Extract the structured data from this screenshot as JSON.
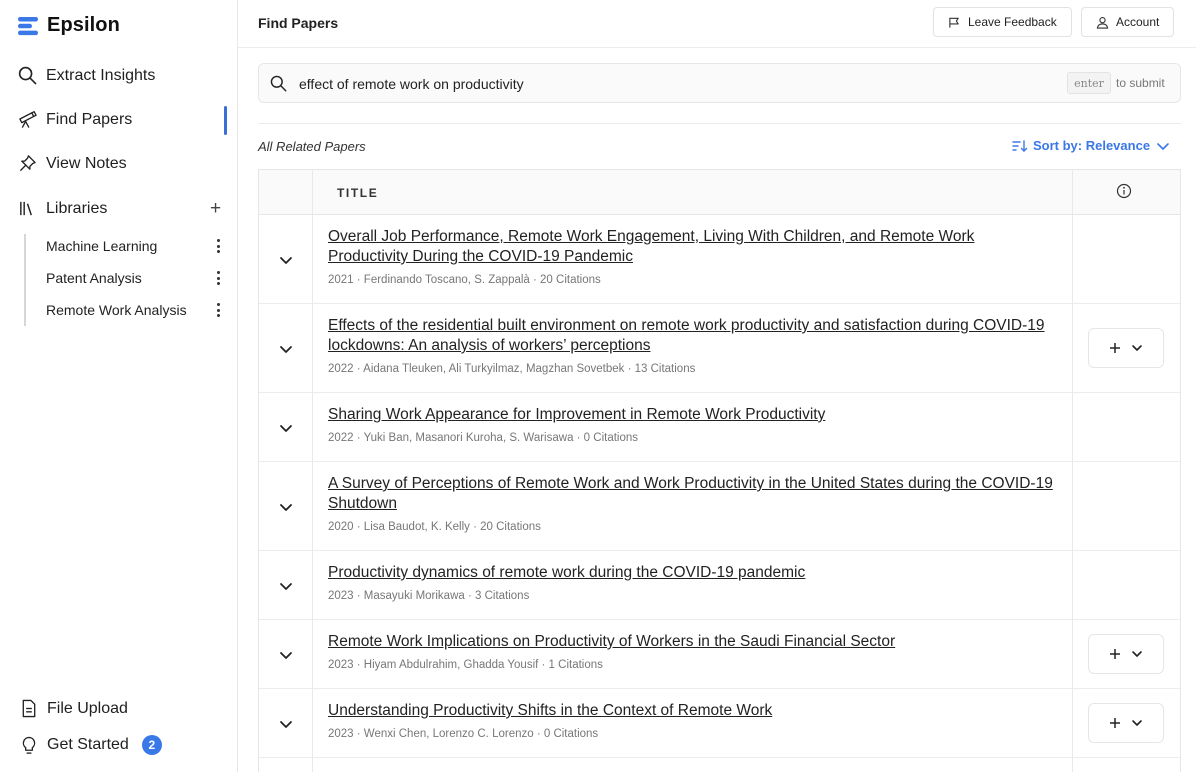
{
  "app": {
    "name": "Epsilon"
  },
  "sidebar": {
    "nav": [
      {
        "label": "Extract Insights",
        "icon": "search-icon"
      },
      {
        "label": "Find Papers",
        "icon": "telescope-icon",
        "active": true
      },
      {
        "label": "View Notes",
        "icon": "pin-icon"
      }
    ],
    "libraries": {
      "label": "Libraries",
      "items": [
        "Machine Learning",
        "Patent Analysis",
        "Remote Work Analysis"
      ]
    },
    "bottom": {
      "file_upload": "File Upload",
      "get_started": "Get Started",
      "get_started_badge": "2"
    }
  },
  "header": {
    "title": "Find Papers",
    "feedback_label": "Leave Feedback",
    "account_label": "Account"
  },
  "search": {
    "value": "effect of remote work on productivity",
    "enter_key": "enter",
    "hint": "to submit"
  },
  "results": {
    "label": "All Related Papers",
    "sort_label": "Sort by: Relevance",
    "column_title": "TITLE",
    "papers": [
      {
        "title": "Overall Job Performance, Remote Work Engagement, Living With Children, and Remote Work Productivity During the COVID-19 Pandemic",
        "meta": "2021 · Ferdinando Toscano, S. Zappalà · 20 Citations",
        "has_add": false
      },
      {
        "title": "Effects of the residential built environment on remote work productivity and satisfaction during COVID-19 lockdowns: An analysis of workers’ perceptions",
        "meta": "2022 · Aidana Tleuken, Ali Turkyilmaz, Magzhan Sovetbek · 13 Citations",
        "has_add": true
      },
      {
        "title": "Sharing Work Appearance for Improvement in Remote Work Productivity",
        "meta": "2022 · Yuki Ban, Masanori Kuroha, S. Warisawa · 0 Citations",
        "has_add": false
      },
      {
        "title": "A Survey of Perceptions of Remote Work and Work Productivity in the United States during the COVID-19 Shutdown",
        "meta": "2020 · Lisa Baudot, K. Kelly · 20 Citations",
        "has_add": false
      },
      {
        "title": "Productivity dynamics of remote work during the COVID-19 pandemic",
        "meta": "2023 · Masayuki Morikawa · 3 Citations",
        "has_add": false
      },
      {
        "title": "Remote Work Implications on Productivity of Workers in the Saudi Financial Sector",
        "meta": "2023 · Hiyam Abdulrahim, Ghadda Yousif · 1 Citations",
        "has_add": true
      },
      {
        "title": "Understanding Productivity Shifts in the Context of Remote Work",
        "meta": "2023 · Wenxi Chen, Lorenzo C. Lorenzo · 0 Citations",
        "has_add": true
      }
    ]
  }
}
